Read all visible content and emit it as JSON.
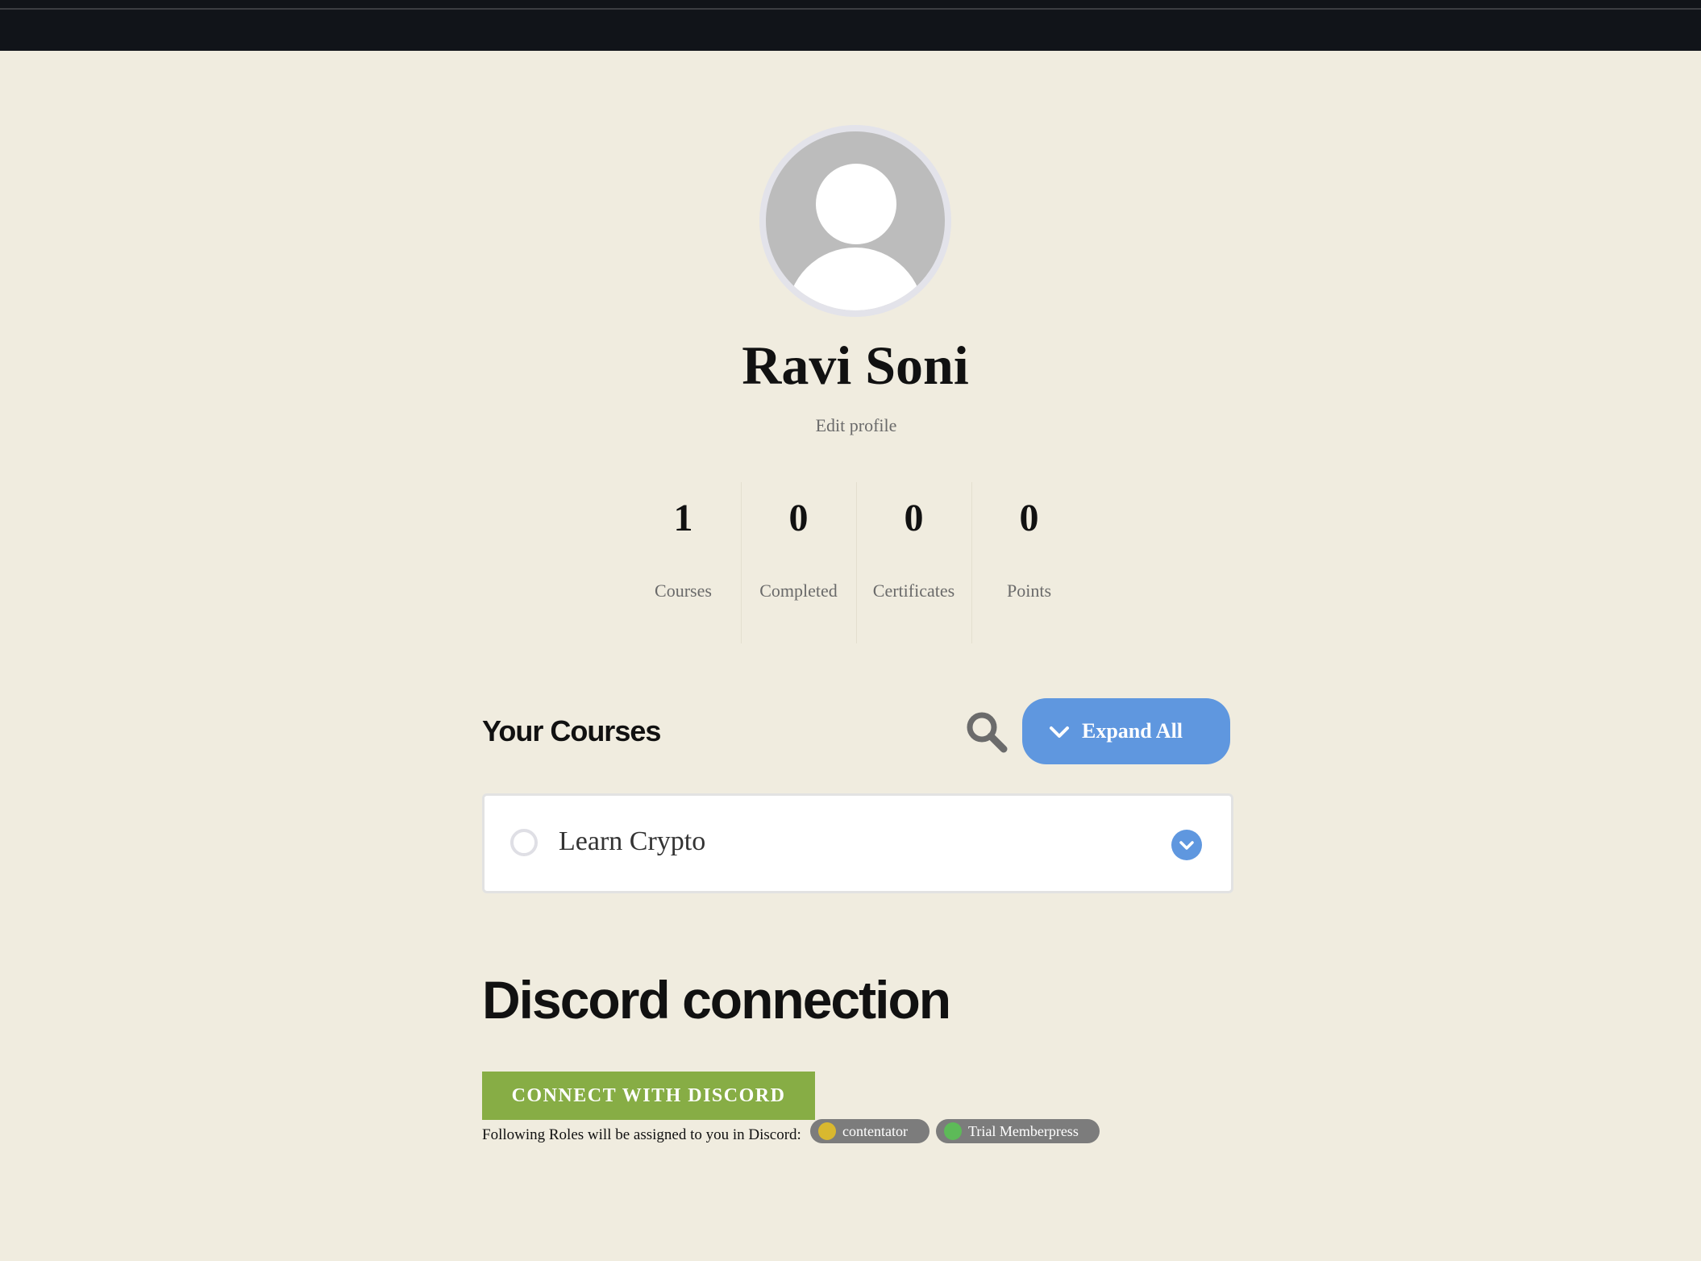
{
  "profile": {
    "name": "Ravi Soni",
    "edit_link": "Edit profile"
  },
  "stats": [
    {
      "value": "1",
      "label": "Courses"
    },
    {
      "value": "0",
      "label": "Completed"
    },
    {
      "value": "0",
      "label": "Certificates"
    },
    {
      "value": "0",
      "label": "Points"
    }
  ],
  "courses": {
    "heading": "Your Courses",
    "expand_label": "Expand All",
    "items": [
      {
        "title": "Learn Crypto"
      }
    ]
  },
  "discord": {
    "heading": "Discord connection",
    "connect_label": "CONNECT WITH DISCORD",
    "roles_text": "Following Roles will be assigned to you in Discord:",
    "roles": [
      {
        "name": "contentator",
        "color": "#d9b82f"
      },
      {
        "name": "Trial Memberpress",
        "color": "#5dba58"
      }
    ]
  },
  "colors": {
    "accent": "#5f97df",
    "discord_button": "#87ad45",
    "background": "#f0ecdf",
    "topbar": "#111419"
  }
}
